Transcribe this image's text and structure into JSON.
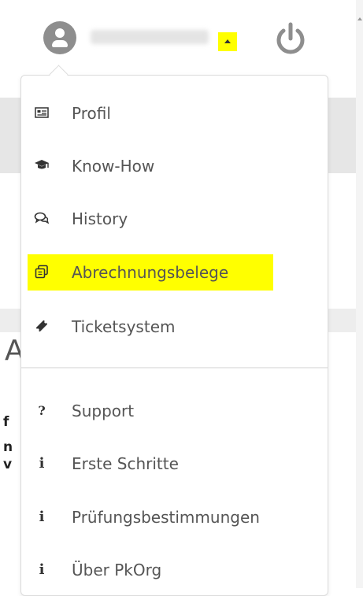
{
  "menu": {
    "items": [
      {
        "label": "Profil",
        "icon": "id-card-icon",
        "highlighted": false
      },
      {
        "label": "Know-How",
        "icon": "graduation-cap-icon",
        "highlighted": false
      },
      {
        "label": "History",
        "icon": "chat-bubbles-icon",
        "highlighted": false
      },
      {
        "label": "Abrechnungsbelege",
        "icon": "copy-documents-icon",
        "highlighted": true
      },
      {
        "label": "Ticketsystem",
        "icon": "ticket-icon",
        "highlighted": false
      }
    ],
    "secondary_items": [
      {
        "label": "Support",
        "icon_glyph": "?",
        "icon": "question-icon"
      },
      {
        "label": "Erste Schritte",
        "icon_glyph": "i",
        "icon": "info-icon"
      },
      {
        "label": "Prüfungsbestimmungen",
        "icon_glyph": "i",
        "icon": "info-icon"
      },
      {
        "label": "Über PkOrg",
        "icon_glyph": "i",
        "icon": "info-icon"
      }
    ]
  },
  "header": {
    "caret_highlight_color": "#ffff00",
    "icons": [
      "user-avatar-icon",
      "caret-up-icon",
      "power-icon"
    ]
  },
  "colors": {
    "highlight": "#ffff00",
    "icon_gray": "#8e8e8e"
  }
}
